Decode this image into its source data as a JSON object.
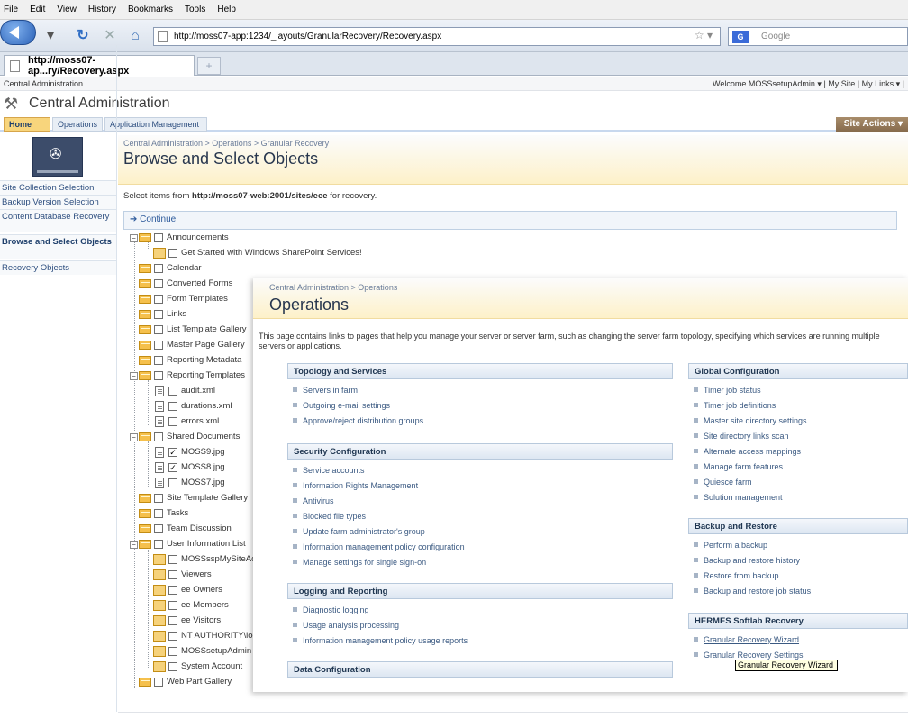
{
  "browser": {
    "menu": [
      "File",
      "Edit",
      "View",
      "History",
      "Bookmarks",
      "Tools",
      "Help"
    ],
    "url": "http://moss07-app:1234/_layouts/GranularRecovery/Recovery.aspx",
    "search_placeholder": "Google",
    "tab_title": "http://moss07-ap...ry/Recovery.aspx",
    "new_tab": "+"
  },
  "sp": {
    "topbar_left": "Central Administration",
    "topbar_right": "Welcome MOSSsetupAdmin ▾ | My Site | My Links ▾ |",
    "title": "Central Administration",
    "tabs": [
      "Home",
      "Operations",
      "Application Management"
    ],
    "site_actions": "Site Actions ▾"
  },
  "leftnav": [
    "Site Collection Selection",
    "Backup Version Selection",
    "Content Database Recovery",
    "Browse and Select Objects",
    "Recovery Objects"
  ],
  "main": {
    "breadcrumb": "Central Administration > Operations > Granular Recovery",
    "title": "Browse and Select Objects",
    "intro_prefix": "Select items from ",
    "intro_url": "http://moss07-web:2001/sites/eee",
    "intro_suffix": " for recovery.",
    "continue": "Continue"
  },
  "tree": [
    "Announcements",
    "Get Started with Windows SharePoint Services!",
    "Calendar",
    "Converted Forms",
    "Form Templates",
    "Links",
    "List Template Gallery",
    "Master Page Gallery",
    "Reporting Metadata",
    "Reporting Templates",
    "audit.xml",
    "durations.xml",
    "errors.xml",
    "Shared Documents",
    "MOSS9.jpg",
    "MOSS8.jpg",
    "MOSS7.jpg",
    "Site Template Gallery",
    "Tasks",
    "Team Discussion",
    "User Information List",
    "MOSSsspMySiteAcc",
    "Viewers",
    "ee Owners",
    "ee Members",
    "ee Visitors",
    "NT AUTHORITY\\local servic",
    "MOSSsetupAdmin",
    "System Account",
    "Web Part Gallery"
  ],
  "ops": {
    "breadcrumb": "Central Administration > Operations",
    "title": "Operations",
    "desc": "This page contains links to pages that help you manage your server or server farm, such as changing the server farm topology, specifying which services are running multiple servers or applications.",
    "sections": {
      "topology": {
        "title": "Topology and Services",
        "links": [
          "Servers in farm",
          "Outgoing e-mail settings",
          "Approve/reject distribution groups"
        ]
      },
      "security": {
        "title": "Security Configuration",
        "links": [
          "Service accounts",
          "Information Rights Management",
          "Antivirus",
          "Blocked file types",
          "Update farm administrator's group",
          "Information management policy configuration",
          "Manage settings for single sign-on"
        ]
      },
      "logging": {
        "title": "Logging and Reporting",
        "links": [
          "Diagnostic logging",
          "Usage analysis processing",
          "Information management policy usage reports"
        ]
      },
      "data": {
        "title": "Data Configuration",
        "links": []
      },
      "global": {
        "title": "Global Configuration",
        "links": [
          "Timer job status",
          "Timer job definitions",
          "Master site directory settings",
          "Site directory links scan",
          "Alternate access mappings",
          "Manage farm features",
          "Quiesce farm",
          "Solution management"
        ]
      },
      "backup": {
        "title": "Backup and Restore",
        "links": [
          "Perform a backup",
          "Backup and restore history",
          "Restore from backup",
          "Backup and restore job status"
        ]
      },
      "hermes": {
        "title": "HERMES Softlab Recovery",
        "links": [
          "Granular Recovery Wizard",
          "Granular Recovery Settings"
        ]
      }
    },
    "tooltip": "Granular Recovery Wizard"
  }
}
